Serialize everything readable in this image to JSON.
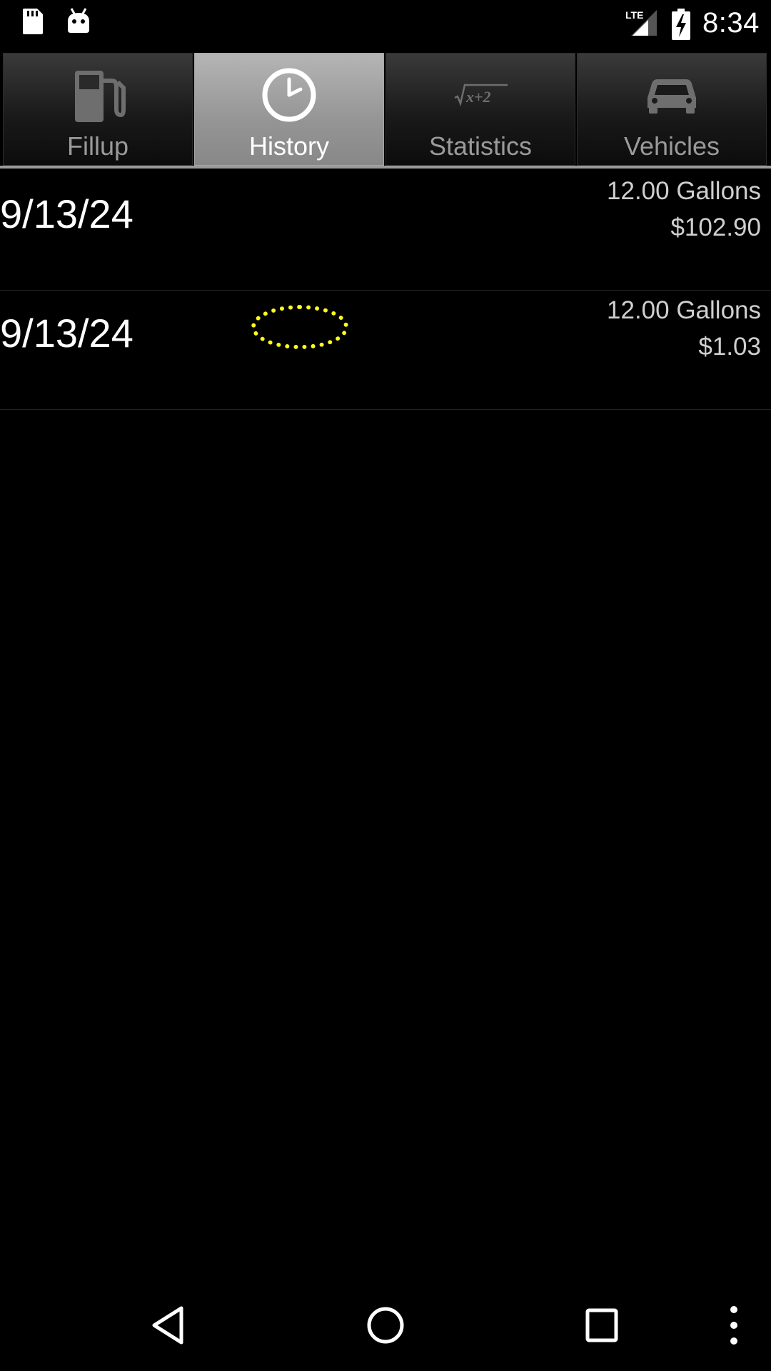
{
  "status_bar": {
    "time": "8:34",
    "network": "LTE",
    "icons": [
      "sd-card-icon",
      "android-debug-icon",
      "lte-signal-icon",
      "battery-charging-icon"
    ]
  },
  "tabs": [
    {
      "label": "Fillup",
      "icon": "gas-pump-icon",
      "active": false
    },
    {
      "label": "History",
      "icon": "clock-icon",
      "active": true
    },
    {
      "label": "Statistics",
      "icon": "math-formula-icon",
      "active": false
    },
    {
      "label": "Vehicles",
      "icon": "car-icon",
      "active": false
    }
  ],
  "history": [
    {
      "date": "9/13/24",
      "gallons": "12.00 Gallons",
      "cost": "$102.90"
    },
    {
      "date": "9/13/24",
      "gallons": "12.00 Gallons",
      "cost": "$1.03"
    }
  ],
  "nav_bar": {
    "icons": [
      "back-icon",
      "home-icon",
      "recents-icon",
      "overflow-menu-icon"
    ]
  },
  "colors": {
    "background": "#000000",
    "active_tab": "#a8a8a8",
    "inactive_label": "#9a9a9a",
    "highlight": "#ffff1a"
  }
}
